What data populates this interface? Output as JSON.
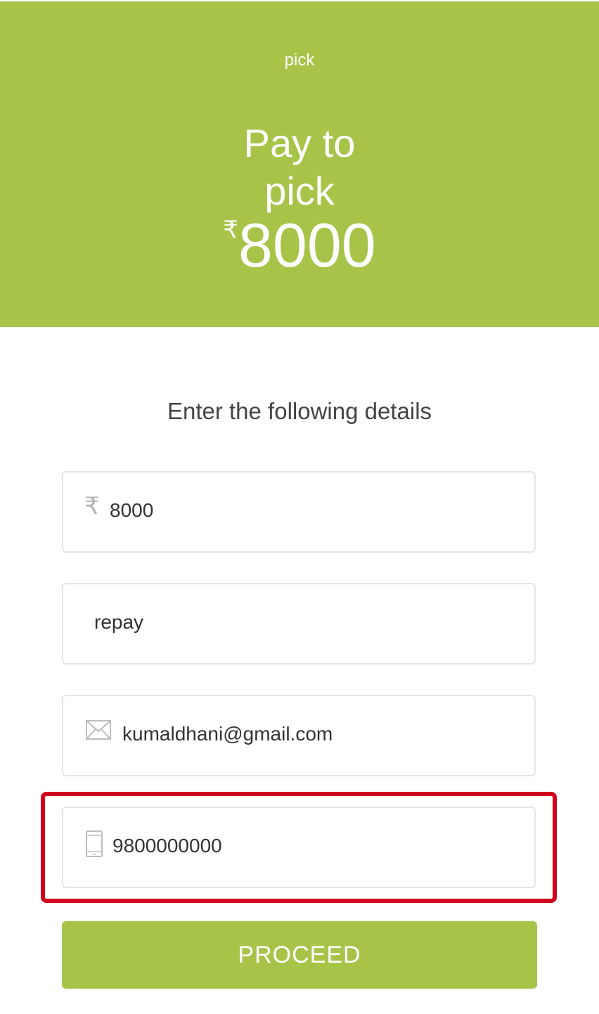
{
  "header": {
    "merchant_small": "pick",
    "pay_title_line1": "Pay to",
    "pay_title_line2": "pick",
    "currency_symbol": "₹",
    "amount": "8000"
  },
  "form": {
    "heading": "Enter the following details",
    "amount_field": {
      "icon": "rupee-icon",
      "value": "8000"
    },
    "purpose_field": {
      "value": "repay"
    },
    "email_field": {
      "icon": "mail-icon",
      "value": "kumaldhani@gmail.com"
    },
    "phone_field": {
      "icon": "phone-icon",
      "value": "9800000000"
    },
    "proceed_label": "PROCEED"
  },
  "colors": {
    "accent": "#a7c449",
    "highlight": "#d0021b"
  }
}
